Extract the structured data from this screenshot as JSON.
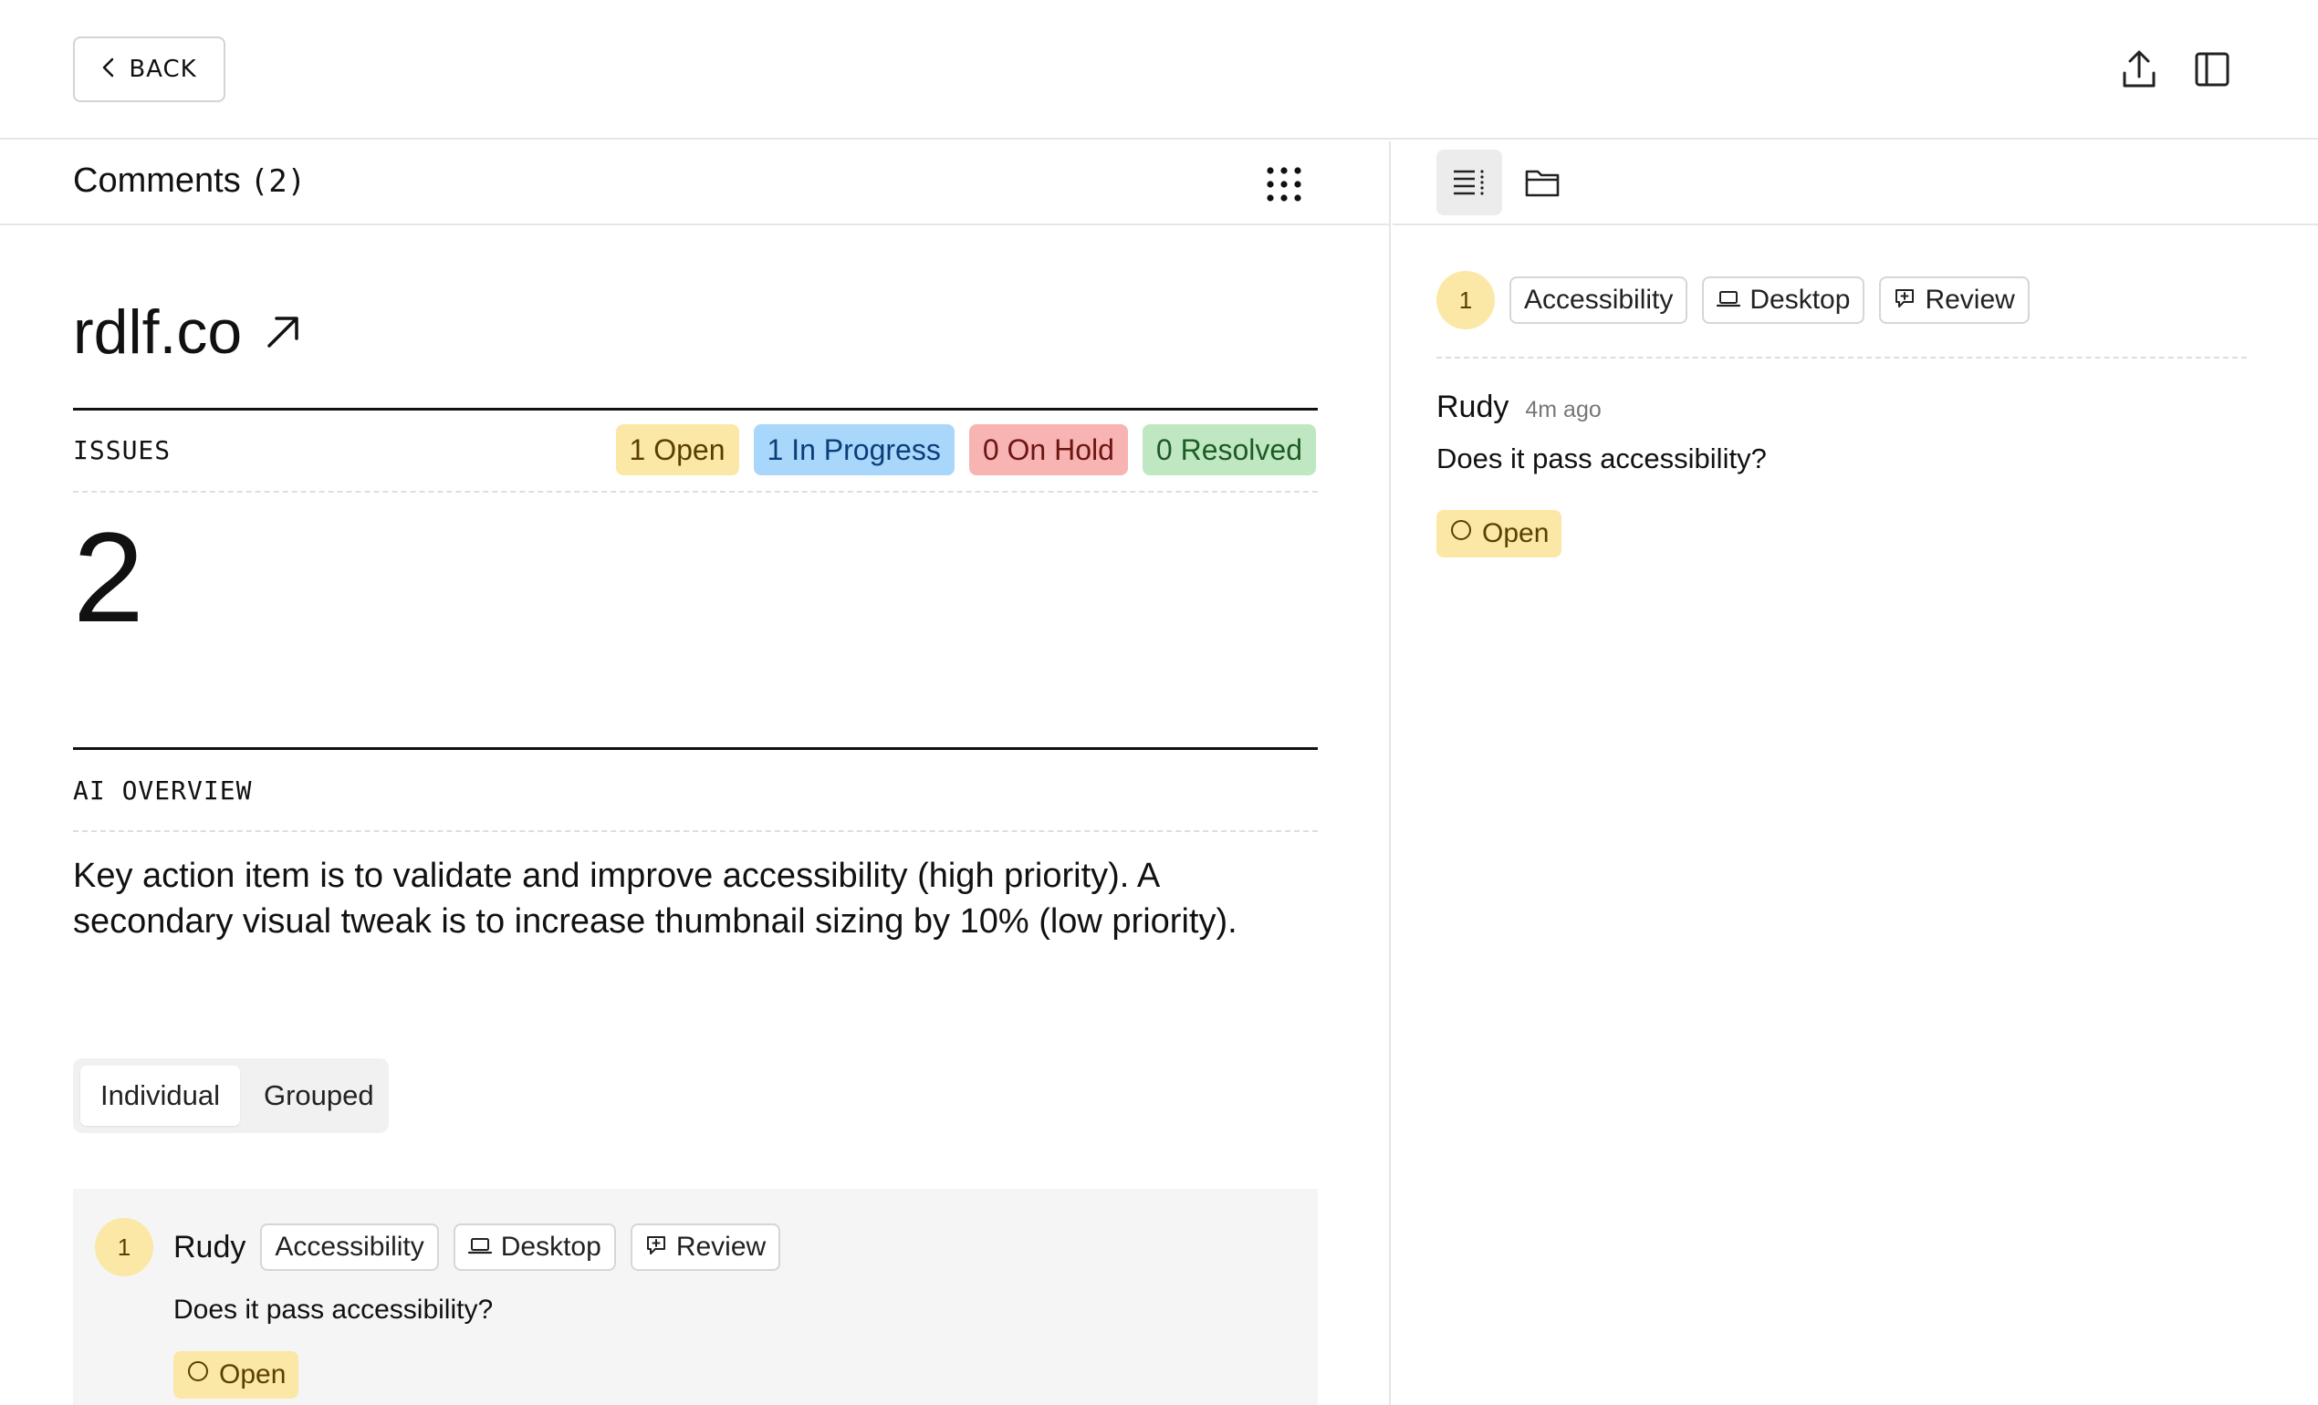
{
  "topbar": {
    "back_label": "BACK",
    "icons": [
      "chevron-left-icon",
      "upload-icon",
      "sidebar-toggle-icon"
    ]
  },
  "comments": {
    "title": "Comments",
    "count": "(2)"
  },
  "site": {
    "name": "rdlf.co"
  },
  "issues": {
    "label": "ISSUES",
    "total": "2",
    "statuses": [
      {
        "label": "1 Open",
        "color": "#fbe8a6"
      },
      {
        "label": "1 In Progress",
        "color": "#a9d6fb"
      },
      {
        "label": "0 On Hold",
        "color": "#f7b4b2"
      },
      {
        "label": "0 Resolved",
        "color": "#bfe8c2"
      }
    ]
  },
  "ai_overview": {
    "label": "AI OVERVIEW",
    "text": "Key action item is to validate and improve accessibility (high priority). A secondary visual tweak is to increase thumbnail sizing by 10% (low priority)."
  },
  "view_toggle": {
    "options": [
      "Individual",
      "Grouped"
    ],
    "selected": "Individual"
  },
  "comment_card": {
    "number": "1",
    "author": "Rudy",
    "tags": [
      "Accessibility",
      "Desktop",
      "Review"
    ],
    "text": "Does it pass accessibility?",
    "status": "Open"
  },
  "detail": {
    "number": "1",
    "tags": [
      "Accessibility",
      "Desktop",
      "Review"
    ],
    "author": "Rudy",
    "time": "4m ago",
    "text": "Does it pass accessibility?",
    "status": "Open"
  },
  "colors": {
    "accent_yellow": "#fbe8a6",
    "divider": "#e6e6e6"
  }
}
